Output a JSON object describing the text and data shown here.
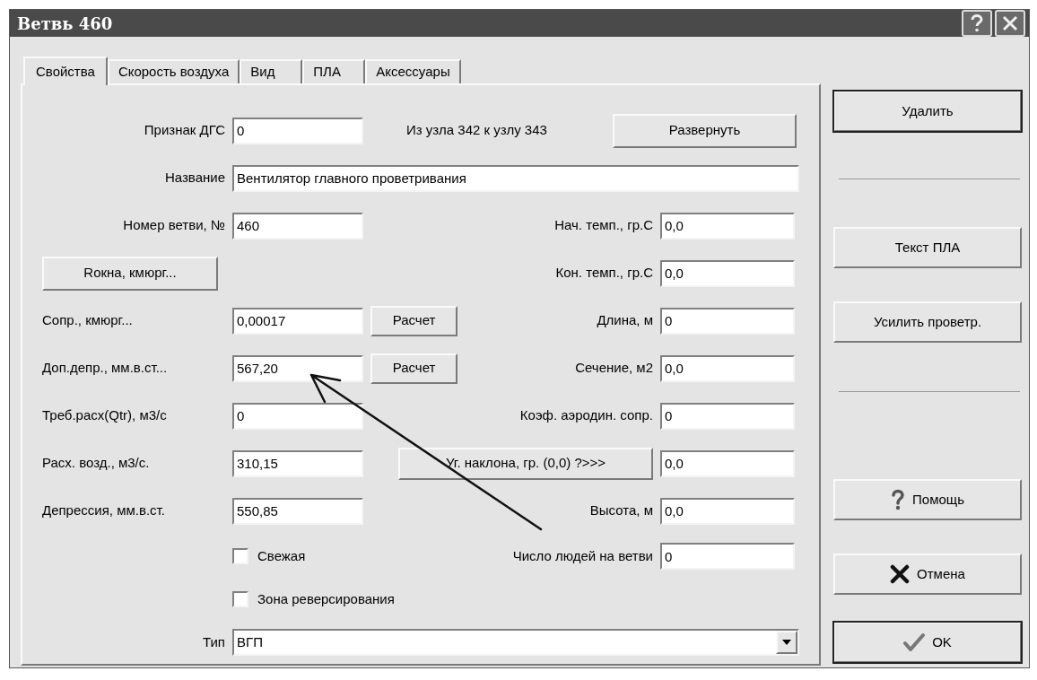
{
  "window": {
    "title": "Ветвь 460"
  },
  "tabs": [
    {
      "label": "Свойства",
      "selected": true
    },
    {
      "label": "Скорость воздуха",
      "selected": false
    },
    {
      "label": "Вид",
      "selected": false
    },
    {
      "label": "ПЛА",
      "selected": false
    },
    {
      "label": "Аксессуары",
      "selected": false
    }
  ],
  "header": {
    "sign": {
      "label": "Признак ДГС",
      "value": "0"
    },
    "route": "Из узла 342 к узлу 343",
    "expand_button": "Развернуть",
    "name": {
      "label": "Название",
      "value": "Вентилятор главного проветривания"
    },
    "number": {
      "label": "Номер ветви, №",
      "value": "460"
    }
  },
  "left_rows": [
    {
      "kind": "button",
      "label": "Rокна, кмюрг..."
    },
    {
      "kind": "field",
      "label": "Сопр., кмюрг...",
      "value": "0,00017",
      "button": "Расчет"
    },
    {
      "kind": "field",
      "label": "Доп.депр., мм.в.ст...",
      "value": "567,20",
      "button": "Расчет"
    },
    {
      "kind": "field",
      "label": "Треб.расх(Qtr), м3/с",
      "value": "0"
    },
    {
      "kind": "field",
      "label": "Расх. возд., м3/с.",
      "value": "310,15"
    },
    {
      "kind": "field",
      "label": "Депрессия, мм.в.ст.",
      "value": "550,85"
    }
  ],
  "right_rows": [
    {
      "kind": "field",
      "label": "Нач. темп., гр.С",
      "value": "0,0"
    },
    {
      "kind": "field",
      "label": "Кон. темп., гр.С",
      "value": "0,0"
    },
    {
      "kind": "field",
      "label": "Длина, м",
      "value": "0"
    },
    {
      "kind": "field",
      "label": "Сечение, м2",
      "value": "0,0"
    },
    {
      "kind": "field",
      "label": "Коэф. аэродин. сопр.",
      "value": "0"
    },
    {
      "kind": "button",
      "label": "Уг. наклона, гр. (0,0) ?>>>",
      "value": "0,0"
    },
    {
      "kind": "field",
      "label": "Высота, м",
      "value": "0,0"
    },
    {
      "kind": "field",
      "label": "Число людей на ветви",
      "value": "0"
    }
  ],
  "checkboxes": [
    {
      "label": "Свежая",
      "checked": false
    },
    {
      "label": "Зона реверсирования",
      "checked": false
    }
  ],
  "type": {
    "label": "Тип",
    "value": "ВГП"
  },
  "side_buttons": [
    {
      "label": "Удалить",
      "kind": "plain",
      "emphasized": true
    },
    {
      "label": "Текст ПЛА",
      "kind": "plain",
      "emphasized": false
    },
    {
      "label": "Усилить проветр.",
      "kind": "plain",
      "emphasized": false
    },
    {
      "label": "Помощь",
      "kind": "help",
      "emphasized": false
    },
    {
      "label": "Отмена",
      "kind": "cancel",
      "emphasized": false
    },
    {
      "label": "OK",
      "kind": "ok",
      "emphasized": true
    }
  ]
}
